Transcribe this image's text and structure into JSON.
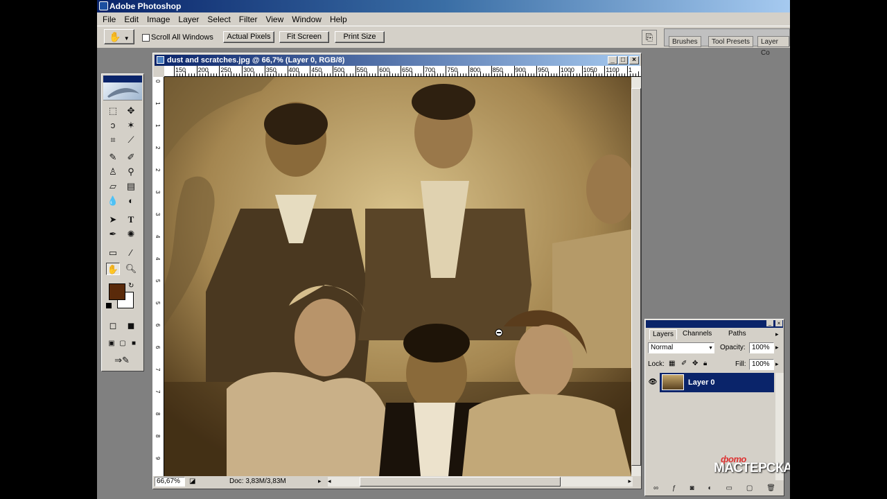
{
  "app": {
    "title": "Adobe Photoshop"
  },
  "menu": [
    "File",
    "Edit",
    "Image",
    "Layer",
    "Select",
    "Filter",
    "View",
    "Window",
    "Help"
  ],
  "options": {
    "scroll_all_label": "Scroll All Windows",
    "actual_pixels": "Actual Pixels",
    "fit_screen": "Fit Screen",
    "print_size": "Print Size"
  },
  "palette_well": {
    "tabs": [
      "Brushes",
      "Tool Presets",
      "Layer Co"
    ]
  },
  "document": {
    "title": "dust and scratches.jpg @ 66,7% (Layer 0, RGB/8)",
    "zoom": "66,67%",
    "doc_size": "Doc: 3,83M/3,83M",
    "ruler_h": [
      "150",
      "200",
      "250",
      "300",
      "350",
      "400",
      "450",
      "500",
      "550",
      "600",
      "650",
      "700",
      "750",
      "800",
      "850",
      "900",
      "950",
      "1000",
      "1050",
      "1100",
      "1"
    ],
    "ruler_v": [
      "0",
      "1",
      "1",
      "2",
      "2",
      "3",
      "3",
      "4",
      "4",
      "5",
      "5",
      "6",
      "6",
      "7",
      "7",
      "8",
      "8",
      "9"
    ]
  },
  "layers_panel": {
    "tabs": [
      "Layers",
      "Channels",
      "Paths"
    ],
    "blend_mode": "Normal",
    "opacity_label": "Opacity:",
    "opacity": "100%",
    "lock_label": "Lock:",
    "fill_label": "Fill:",
    "fill": "100%",
    "layer_name": "Layer 0"
  },
  "watermark": {
    "top": "фото",
    "main": "МАСТЕРСКАЯ"
  },
  "colors": {
    "foreground": "#5a2a0a",
    "background": "#ffffff",
    "titlebar": "#0a246a"
  }
}
